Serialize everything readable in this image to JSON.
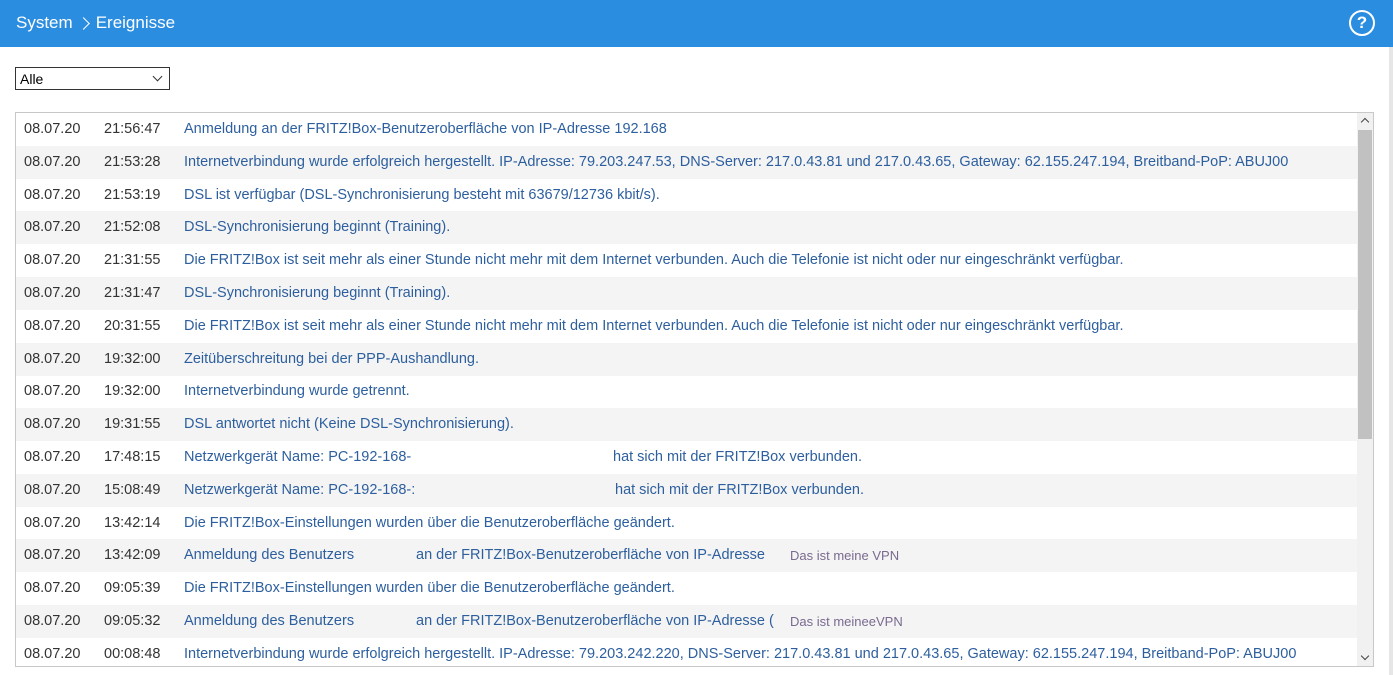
{
  "header": {
    "crumb_system": "System",
    "crumb_current": "Ereignisse",
    "help_label": "?"
  },
  "filter": {
    "selected": "Alle"
  },
  "events": [
    {
      "date": "08.07.20",
      "time": "21:56:47",
      "msg": "Anmeldung an der FRITZ!Box-Benutzeroberfläche von IP-Adresse 192.168"
    },
    {
      "date": "08.07.20",
      "time": "21:53:28",
      "msg": "Internetverbindung wurde erfolgreich hergestellt. IP-Adresse: 79.203.247.53, DNS-Server: 217.0.43.81 und 217.0.43.65, Gateway: 62.155.247.194, Breitband-PoP: ABUJ00"
    },
    {
      "date": "08.07.20",
      "time": "21:53:19",
      "msg": "DSL ist verfügbar (DSL-Synchronisierung besteht mit 63679/12736 kbit/s)."
    },
    {
      "date": "08.07.20",
      "time": "21:52:08",
      "msg": "DSL-Synchronisierung beginnt (Training)."
    },
    {
      "date": "08.07.20",
      "time": "21:31:55",
      "msg": "Die FRITZ!Box ist seit mehr als einer Stunde nicht mehr mit dem Internet verbunden. Auch die Telefonie ist nicht oder nur eingeschränkt verfügbar."
    },
    {
      "date": "08.07.20",
      "time": "21:31:47",
      "msg": "DSL-Synchronisierung beginnt (Training)."
    },
    {
      "date": "08.07.20",
      "time": "20:31:55",
      "msg": "Die FRITZ!Box ist seit mehr als einer Stunde nicht mehr mit dem Internet verbunden. Auch die Telefonie ist nicht oder nur eingeschränkt verfügbar."
    },
    {
      "date": "08.07.20",
      "time": "19:32:00",
      "msg": "Zeitüberschreitung bei der PPP-Aushandlung."
    },
    {
      "date": "08.07.20",
      "time": "19:32:00",
      "msg": "Internetverbindung wurde getrennt."
    },
    {
      "date": "08.07.20",
      "time": "19:31:55",
      "msg": "DSL antwortet nicht (Keine DSL-Synchronisierung)."
    },
    {
      "date": "08.07.20",
      "time": "17:48:15",
      "msg": "Netzwerkgerät Name: PC-192-168-",
      "msg2": "hat sich mit der FRITZ!Box verbunden."
    },
    {
      "date": "08.07.20",
      "time": "15:08:49",
      "msg": "Netzwerkgerät Name: PC-192-168-:",
      "msg2": "hat sich mit der FRITZ!Box verbunden."
    },
    {
      "date": "08.07.20",
      "time": "13:42:14",
      "msg": "Die FRITZ!Box-Einstellungen wurden über die Benutzeroberfläche geändert."
    },
    {
      "date": "08.07.20",
      "time": "13:42:09",
      "msg": "Anmeldung des Benutzers",
      "msg2": "an der FRITZ!Box-Benutzeroberfläche von IP-Adresse",
      "note": "Das ist meine VPN"
    },
    {
      "date": "08.07.20",
      "time": "09:05:39",
      "msg": "Die FRITZ!Box-Einstellungen wurden über die Benutzeroberfläche geändert."
    },
    {
      "date": "08.07.20",
      "time": "09:05:32",
      "msg": "Anmeldung des Benutzers",
      "msg2": "an der FRITZ!Box-Benutzeroberfläche von IP-Adresse (",
      "note": "Das ist meineeVPN"
    },
    {
      "date": "08.07.20",
      "time": "00:08:48",
      "msg": "Internetverbindung wurde erfolgreich hergestellt. IP-Adresse: 79.203.242.220, DNS-Server: 217.0.43.81 und 217.0.43.65, Gateway: 62.155.247.194, Breitband-PoP: ABUJ00"
    }
  ]
}
